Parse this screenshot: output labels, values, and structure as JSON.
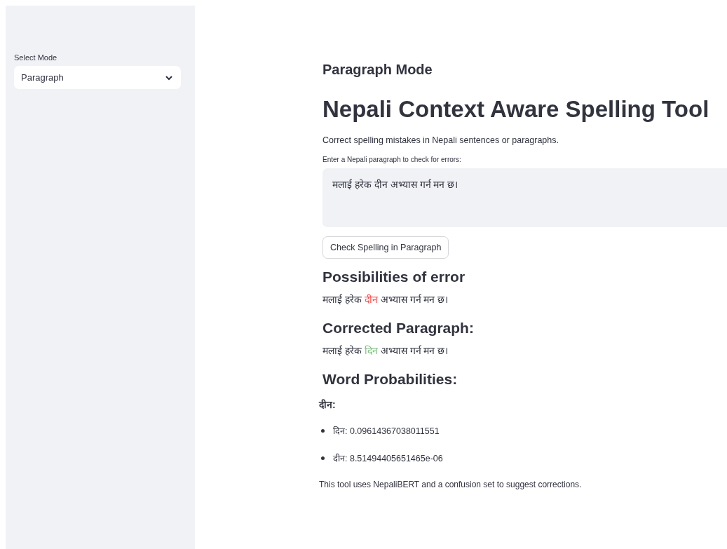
{
  "sidebar": {
    "select": {
      "label": "Select Mode",
      "value": "Paragraph"
    }
  },
  "main": {
    "subtitle": "Paragraph Mode",
    "title": "Nepali Context Aware Spelling Tool",
    "description": "Correct spelling mistakes in Nepali sentences or paragraphs.",
    "input": {
      "label": "Enter a Nepali paragraph to check for errors:",
      "value": "मलाई हरेक दीन अभ्यास गर्न मन छ।"
    },
    "button": "Check Spelling in Paragraph",
    "sections": [
      {
        "heading": "Possibilities of error",
        "segments": [
          {
            "text": "मलाई हरेक ",
            "kind": "plain"
          },
          {
            "text": "दीन",
            "kind": "error"
          },
          {
            "text": " अभ्यास गर्न मन छ।",
            "kind": "plain"
          }
        ]
      },
      {
        "heading": "Corrected Paragraph:",
        "segments": [
          {
            "text": "मलाई हरेक ",
            "kind": "plain"
          },
          {
            "text": "दिन",
            "kind": "correction"
          },
          {
            "text": " अभ्यास गर्न मन छ।",
            "kind": "plain"
          }
        ]
      }
    ],
    "probabilities": {
      "heading": "Word Probabilities:",
      "word": "दीन:",
      "items": [
        {
          "text": "दिन: 0.09614367038011551"
        },
        {
          "text": "दीन: 8.51494405651465e-06"
        }
      ]
    },
    "footer": "This tool uses NepaliBERT and a confusion set to suggest corrections."
  }
}
